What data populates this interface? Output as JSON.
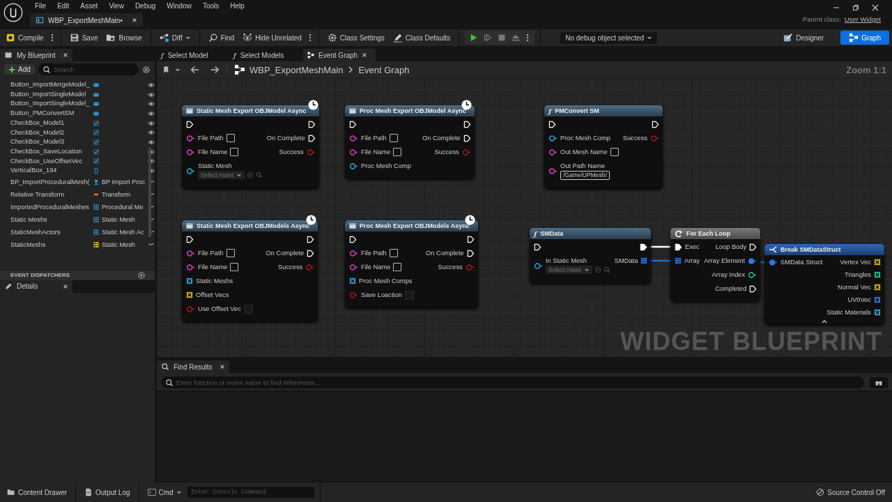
{
  "window": {
    "menu": [
      "File",
      "Edit",
      "Asset",
      "View",
      "Debug",
      "Window",
      "Tools",
      "Help"
    ],
    "document_tab": "WBP_ExportMeshMain•",
    "parent_class_label": "Parent class:",
    "parent_class": "User Widget"
  },
  "toolbar": {
    "buttons": [
      {
        "label": "Compile",
        "kind": "compile",
        "more": true
      },
      {
        "label": "Save",
        "kind": "save",
        "more": false
      },
      {
        "label": "Browse",
        "kind": "browse",
        "more": false
      },
      {
        "label": "Diff",
        "kind": "diff",
        "more": false
      },
      {
        "label": "Find",
        "kind": "find",
        "more": false
      },
      {
        "label": "Hide Unrelated",
        "kind": "hide",
        "more": true
      },
      {
        "label": "Class Settings",
        "kind": "settings",
        "more": false
      },
      {
        "label": "Class Defaults",
        "kind": "defaults",
        "more": false
      }
    ],
    "debug_select": "No debug object selected",
    "modes": [
      {
        "label": "Designer",
        "kind": "designer",
        "selected": false
      },
      {
        "label": "Graph",
        "kind": "graph",
        "selected": true
      }
    ]
  },
  "my_blueprint": {
    "title": "My Blueprint",
    "add": "Add",
    "search_placeholder": "Search",
    "items": [
      {
        "name": "Button_ImportMergeModel_",
        "kind": "button"
      },
      {
        "name": "Button_ImportSingleModel",
        "kind": "button"
      },
      {
        "name": "Button_ImportSingleModel_",
        "kind": "button"
      },
      {
        "name": "Button_PMConvertSM",
        "kind": "button"
      },
      {
        "name": "CheckBox_Model1",
        "kind": "checkbox"
      },
      {
        "name": "CheckBox_Model2",
        "kind": "checkbox"
      },
      {
        "name": "CheckBox_Model3",
        "kind": "checkbox"
      },
      {
        "name": "CheckBox_SaveLocation",
        "kind": "checkbox"
      },
      {
        "name": "CheckBox_UseOffsetVec",
        "kind": "checkbox"
      },
      {
        "name": "VerticalBox_194",
        "kind": "vertical_box"
      },
      {
        "name": "BP_ImportProceduralMesh(",
        "kind": "object",
        "type": "BP Import Proc"
      },
      {
        "name": "Relative Transform",
        "kind": "struct",
        "type": "Transform"
      },
      {
        "name": "ImportedProceduralMeshes",
        "kind": "array",
        "type": "Procedural Me"
      },
      {
        "name": "Static Meshs",
        "kind": "array",
        "type": "Static Mesh"
      },
      {
        "name": "StaticMeshActors",
        "kind": "array",
        "type": "Static Mesh Ac"
      },
      {
        "name": "StaticMeshs",
        "kind": "set",
        "type": "Static Mesh"
      }
    ],
    "section": "EVENT DISPATCHERS"
  },
  "details": {
    "title": "Details"
  },
  "graph": {
    "tabs": [
      {
        "label": "Select Model",
        "kind": "function",
        "icon": "ƒ",
        "selected": false
      },
      {
        "label": "Select Models",
        "kind": "function",
        "icon": "ƒ",
        "selected": false
      },
      {
        "label": "Event Graph",
        "kind": "graph",
        "selected": true
      }
    ],
    "breadcrumb": [
      "WBP_ExportMeshMain",
      "Event Graph"
    ],
    "zoom": "Zoom 1:1",
    "watermark": "WIDGET BLUEPRINT",
    "nodes": [
      {
        "title": "Static Mesh Export OBJModel Async",
        "kind": "async",
        "inputs": [
          {
            "kind": "exec",
            "connected": false
          },
          {
            "label": "File Path",
            "kind": "string",
            "text_box": true,
            "connected": false
          },
          {
            "label": "File Name",
            "kind": "string",
            "text_box": true,
            "connected": false
          },
          {
            "label": "Static Mesh",
            "kind": "object",
            "asset_picker": "Select Asset",
            "connected": false
          }
        ],
        "outputs": [
          {
            "kind": "exec",
            "connected": false
          },
          {
            "label": "On Complete",
            "kind": "exec",
            "connected": false
          },
          {
            "label": "Success",
            "kind": "bool",
            "connected": false
          }
        ]
      },
      {
        "title": "Proc Mesh Export OBJModel Async",
        "kind": "async",
        "inputs": [
          {
            "kind": "exec",
            "connected": false
          },
          {
            "label": "File Path",
            "kind": "string",
            "text_box": true,
            "connected": false
          },
          {
            "label": "File Name",
            "kind": "string",
            "text_box": true,
            "connected": false
          },
          {
            "label": "Proc Mesh Comp",
            "kind": "object",
            "connected": false
          }
        ],
        "outputs": [
          {
            "kind": "exec",
            "connected": false
          },
          {
            "label": "On Complete",
            "kind": "exec",
            "connected": false
          },
          {
            "label": "Success",
            "kind": "bool",
            "connected": false
          }
        ]
      },
      {
        "title": "PMConvert SM",
        "kind": "function",
        "icon": "ƒ",
        "inputs": [
          {
            "kind": "exec",
            "connected": false
          },
          {
            "label": "Proc Mesh Comp",
            "kind": "object",
            "connected": false
          },
          {
            "label": "Out Mesh Name",
            "kind": "string",
            "text_box": true,
            "connected": false
          },
          {
            "label": "Out Path Name",
            "kind": "string",
            "default_value": "/Game/UPMesh/",
            "connected": false
          }
        ],
        "outputs": [
          {
            "kind": "exec",
            "connected": false
          },
          {
            "label": "Success",
            "kind": "bool",
            "connected": false
          }
        ]
      },
      {
        "title": "Static Mesh Export OBJModels Async",
        "kind": "async",
        "inputs": [
          {
            "kind": "exec",
            "connected": false
          },
          {
            "label": "File Path",
            "kind": "string",
            "text_box": true,
            "connected": false
          },
          {
            "label": "File Name",
            "kind": "string",
            "text_box": true,
            "connected": false
          },
          {
            "label": "Static Meshs",
            "kind": "object_array",
            "connected": false
          },
          {
            "label": "Offset Vecs",
            "kind": "vector_array",
            "connected": false
          },
          {
            "label": "Use Offset Vec",
            "kind": "bool",
            "checked": false,
            "connected": false
          }
        ],
        "outputs": [
          {
            "kind": "exec",
            "connected": false
          },
          {
            "label": "On Complete",
            "kind": "exec",
            "connected": false
          },
          {
            "label": "Success",
            "kind": "bool",
            "connected": false
          }
        ]
      },
      {
        "title": "Proc Mesh Export OBJModels Async",
        "kind": "async",
        "inputs": [
          {
            "kind": "exec",
            "connected": false
          },
          {
            "label": "File Path",
            "kind": "string",
            "text_box": true,
            "connected": false
          },
          {
            "label": "File Name",
            "kind": "string",
            "text_box": true,
            "connected": false
          },
          {
            "label": "Proc Mesh Comps",
            "kind": "object_array",
            "connected": false
          },
          {
            "label": "Save Loaction",
            "kind": "bool",
            "checked": false,
            "connected": false
          }
        ],
        "outputs": [
          {
            "kind": "exec",
            "connected": false
          },
          {
            "label": "On Complete",
            "kind": "exec",
            "connected": false
          },
          {
            "label": "Success",
            "kind": "bool",
            "connected": false
          }
        ]
      },
      {
        "title": "SMData",
        "kind": "function",
        "icon": "ƒ",
        "inputs": [
          {
            "kind": "exec",
            "connected": false
          },
          {
            "label": "In Static Mesh",
            "kind": "object",
            "asset_picker": "Select Asset",
            "connected": false
          }
        ],
        "outputs": [
          {
            "kind": "exec",
            "connected": true
          },
          {
            "label": "SMData",
            "kind": "struct_array",
            "connected": true
          }
        ]
      },
      {
        "title": "For Each Loop",
        "kind": "loop",
        "inputs": [
          {
            "label": "Exec",
            "kind": "exec",
            "connected": true
          },
          {
            "label": "Array",
            "kind": "struct_array",
            "connected": true
          }
        ],
        "outputs": [
          {
            "label": "Loop Body",
            "kind": "exec",
            "connected": false
          },
          {
            "label": "Array Element",
            "kind": "struct",
            "connected": true
          },
          {
            "label": "Array Index",
            "kind": "int",
            "connected": false
          },
          {
            "label": "Completed",
            "kind": "exec",
            "connected": false
          }
        ]
      },
      {
        "title": "Break SMDataStruct",
        "kind": "break",
        "advanced_toggle": true,
        "inputs": [
          {
            "label": "SMData Struct",
            "kind": "struct",
            "connected": true
          }
        ],
        "outputs": [
          {
            "label": "Vertex Vec",
            "kind": "vector_array",
            "connected": false
          },
          {
            "label": "Triangles",
            "kind": "int_array",
            "connected": false
          },
          {
            "label": "Normal Vec",
            "kind": "vector_array",
            "connected": false
          },
          {
            "label": "UV0Vec",
            "kind": "vector2d_array",
            "connected": false
          },
          {
            "label": "Static Materials",
            "kind": "object_array",
            "connected": false
          }
        ]
      }
    ]
  },
  "find_results": {
    "title": "Find Results",
    "placeholder": "Enter function or event name to find references..."
  },
  "status_bar": {
    "content_drawer": "Content Drawer",
    "output_log": "Output Log",
    "cmd": "Cmd",
    "console_placeholder": "Enter Console Command",
    "source_control": "Source Control Off"
  }
}
